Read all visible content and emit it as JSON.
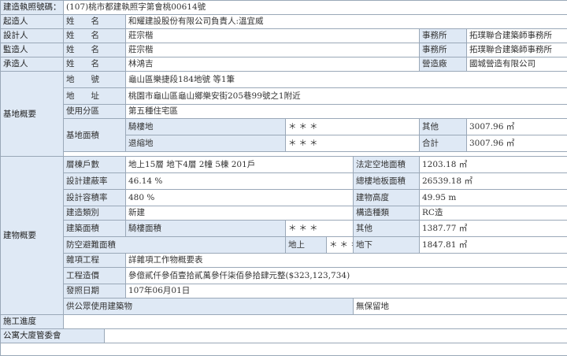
{
  "permit": {
    "label": "建造執照號碼：",
    "value": "(107)桃市都建執照字第會桃00614號"
  },
  "builder": {
    "label": "起造人",
    "field": "姓　　名",
    "value": "和耀建設股份有限公司負責人:溫宜威"
  },
  "designer": {
    "label": "設計人",
    "field": "姓　　名",
    "value": "莊宗楷",
    "office_label": "事務所",
    "office": "拓璞聯合建築師事務所"
  },
  "supervisor": {
    "label": "監造人",
    "field": "姓　　名",
    "value": "莊宗楷",
    "office_label": "事務所",
    "office": "拓璞聯合建築師事務所"
  },
  "contractor": {
    "label": "承造人",
    "field": "姓　　名",
    "value": "林鴻吉",
    "company_label": "營造廠",
    "company": "國城營造有限公司"
  },
  "site": {
    "section_label": "基地概要",
    "lot_label": "地　　號",
    "lot_value": "龜山區樂捷段184地號 等1筆",
    "address_label": "地　　址",
    "address_value": "桃園市龜山區龜山鄉樂安街205巷99號之1附近",
    "zoning_label": "使用分區",
    "zoning_value": "第五種住宅區",
    "area_label": "基地面積",
    "arcade_label": "騎樓地",
    "arcade_value": "＊＊＊",
    "setback_label": "退縮地",
    "setback_value": "＊＊＊",
    "other_label": "其他",
    "other_value": "3007.96 ㎡",
    "total_label": "合計",
    "total_value": "3007.96 ㎡"
  },
  "building": {
    "section_label": "建物概要",
    "floors_label": "層棟戶數",
    "floors_value": "地上15層 地下4層 2幢 5棟 201戶",
    "vacant_label": "法定空地面積",
    "vacant_value": "1203.18 ㎡",
    "coverage_label": "設計建蔽率",
    "coverage_value": "46.14 %",
    "floor_area_label": "總樓地板面積",
    "floor_area_value": "26539.18 ㎡",
    "far_label": "設計容積率",
    "far_value": "480 %",
    "height_label": "建物高度",
    "height_value": "49.95 m",
    "type_label": "建造類別",
    "type_value": "新建",
    "structure_label": "構造種類",
    "structure_value": "RC造",
    "building_area_label": "建築面積",
    "arcade_area_label": "騎樓面積",
    "arcade_area_value": "＊＊＊",
    "other_area_label": "其他",
    "other_area_value": "1387.77 ㎡",
    "shelter_label": "防空避難面積",
    "above_label": "地上",
    "above_value": "＊＊＊",
    "below_label": "地下",
    "below_value": "1847.81 ㎡",
    "misc_label": "雜項工程",
    "misc_value": "詳雜項工作物概要表",
    "cost_label": "工程造價",
    "cost_value": "參億貳仟參佰壹拾貳萬參仟柒佰參拾肆元整($323,123,734)",
    "issue_label": "發照日期",
    "issue_value": "107年06月01日",
    "public_label": "供公眾使用建築物",
    "public_value": "無保留地"
  },
  "progress": {
    "label": "施工進度"
  },
  "committee": {
    "label": "公寓大廈管委會"
  }
}
